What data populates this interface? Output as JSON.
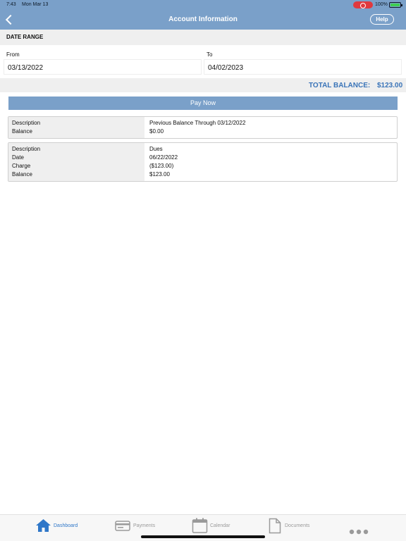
{
  "status_bar": {
    "time": "7:43",
    "date": "Mon Mar 13",
    "battery_percent": "100%",
    "battery_level": 1.0
  },
  "header": {
    "title": "Account Information",
    "help_label": "Help"
  },
  "date_range": {
    "section_title": "DATE RANGE",
    "from_label": "From",
    "from_value": "03/13/2022",
    "to_label": "To",
    "to_value": "04/02/2023"
  },
  "totals": {
    "label": "TOTAL BALANCE:",
    "value": "$123.00"
  },
  "pay_now_label": "Pay Now",
  "transactions": [
    {
      "rows": [
        {
          "key": "Description",
          "value": "Previous Balance Through 03/12/2022"
        },
        {
          "key": "Balance",
          "value": "$0.00"
        }
      ]
    },
    {
      "rows": [
        {
          "key": "Description",
          "value": "Dues"
        },
        {
          "key": "Date",
          "value": "06/22/2022"
        },
        {
          "key": "Charge",
          "value": "($123.00)"
        },
        {
          "key": "Balance",
          "value": "$123.00"
        }
      ]
    }
  ],
  "tabbar": {
    "tabs": [
      {
        "label": "Dashboard",
        "icon": "home-icon",
        "active": true
      },
      {
        "label": "Payments",
        "icon": "credit-card-icon",
        "active": false
      },
      {
        "label": "Calendar",
        "icon": "calendar-icon",
        "active": false
      },
      {
        "label": "Documents",
        "icon": "document-icon",
        "active": false
      },
      {
        "label": "",
        "icon": "more-icon",
        "active": false
      }
    ]
  },
  "colors": {
    "header_blue": "#7aa0c9",
    "accent_blue": "#3a74b8",
    "tab_active": "#2f77c8",
    "tab_inactive": "#9a9a9a"
  }
}
